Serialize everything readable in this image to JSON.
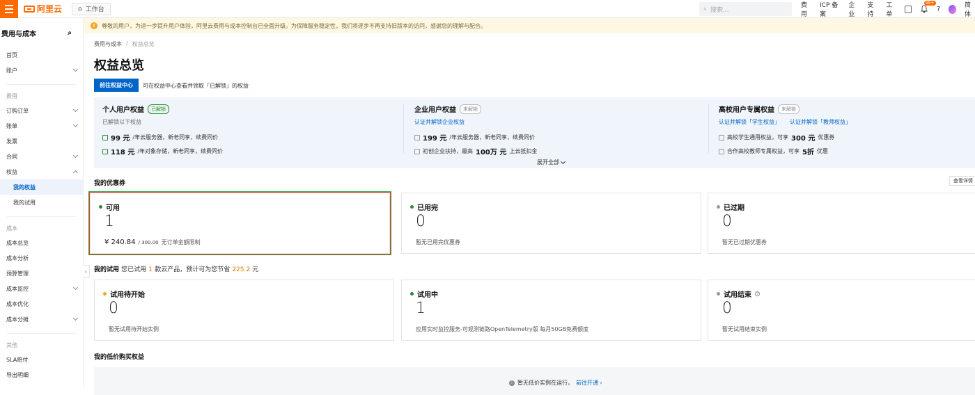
{
  "topbar": {
    "logo_text": "阿里云",
    "workbench": "工作台",
    "search_placeholder": "搜索...",
    "links": [
      "费用",
      "ICP 备案",
      "企业",
      "支持",
      "工单"
    ],
    "notify_badge": "99+",
    "lang": "简体"
  },
  "notice": "尊敬的用户，为进一步提升用户体验，阿里云费用与成本控制台已全面升级。为保障服务稳定性，我们将逐步不再支持旧版本的访问，感谢您的理解与配合。",
  "sidebar": {
    "title": "费用与成本",
    "top_items": [
      "首页",
      "账户"
    ],
    "fee_section": "费用",
    "fee_items": [
      "订购订单",
      "账单",
      "发票",
      "合同",
      "权益"
    ],
    "fee_sub_items": [
      "我的权益",
      "我的试用"
    ],
    "cost_section": "成本",
    "cost_items": [
      "成本总览",
      "成本分析",
      "预算管理",
      "成本监控",
      "成本优化",
      "成本分摊"
    ],
    "other_section": "其他",
    "other_items": [
      "SLA赔付",
      "导出明细"
    ]
  },
  "breadcrumb": [
    "费用与成本",
    "权益总览"
  ],
  "page_title": "权益总览",
  "go_button": "前往权益中心",
  "go_desc": "可在权益中心查看并领取「已解锁」的权益",
  "benefits": {
    "personal": {
      "title": "个人用户权益",
      "tag": "已解锁",
      "sub": "已解锁以下权益",
      "lines": [
        {
          "price": "99 元",
          "text": "/年云服务器，新老同享，续费同价"
        },
        {
          "price": "118 元",
          "text": "/年对象存储，新老同享，续费同价"
        }
      ]
    },
    "enterprise": {
      "title": "企业用户权益",
      "tag": "未解锁",
      "link": "认证并解锁企业权益",
      "line1_price": "199 元",
      "line1_text": "/年云服务器，新老同享，续费同价",
      "line2_pre": "初创企业扶持，最高",
      "line2_amount": "100万 元",
      "line2_post": "上云抵扣金"
    },
    "campus": {
      "title": "高校用户专属权益",
      "tag": "未解锁",
      "links": [
        "认证并解锁「学生权益」",
        "认证并解锁「教师权益」"
      ],
      "line1_pre": "高校学生通用权益，可享",
      "line1_amount": "300 元",
      "line1_post": "优惠券",
      "line2_pre": "合作高校教师专属权益，可享",
      "line2_amount": "5折",
      "line2_post": "优惠"
    },
    "expand": "展开全部"
  },
  "coupons": {
    "title": "我的优惠券",
    "detail_button": "查看详情",
    "cards": [
      {
        "title": "可用",
        "count": "1",
        "amount": "¥ 240.84",
        "total": "/ 300.00",
        "note": "无订单金额限制",
        "color": "#2b8a3e"
      },
      {
        "title": "已用完",
        "count": "0",
        "note": "暂无已用完优惠券",
        "color": "#2b8a3e"
      },
      {
        "title": "已过期",
        "count": "0",
        "note": "暂无已过期优惠券",
        "color": "#999999"
      }
    ]
  },
  "trials": {
    "title": "我的试用",
    "summary_pre": "您已试用",
    "summary_count": "1",
    "summary_mid": "款云产品，预计可为您节省",
    "summary_amount": "225.2",
    "summary_post": "元",
    "cards": [
      {
        "title": "试用待开始",
        "count": "0",
        "note": "暂无试用待开始实例",
        "color": "#f5a623"
      },
      {
        "title": "试用中",
        "count": "1",
        "note": "应用实时监控服务-可观测链路OpenTelemetry版 每月50GB免费额度",
        "color": "#2b8a3e"
      },
      {
        "title": "试用结束",
        "count": "0",
        "note": "暂无试用结束实例",
        "color": "#999999"
      }
    ]
  },
  "lowprice": {
    "title": "我的低价购买权益",
    "msg": "暂无低价实例在运行，",
    "link": "前往开通"
  }
}
